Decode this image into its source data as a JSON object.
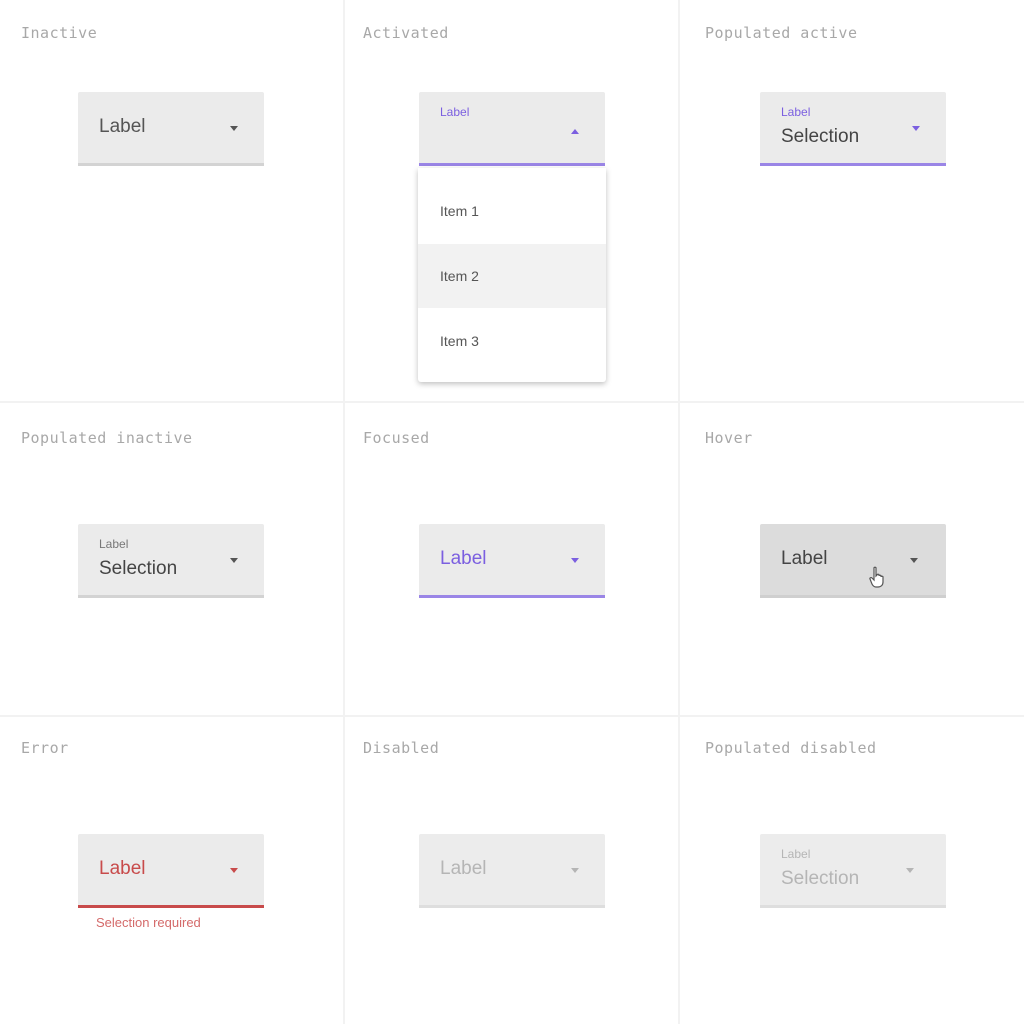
{
  "cells": {
    "inactive": {
      "title": "Inactive",
      "label": "Label"
    },
    "activated": {
      "title": "Activated",
      "label": "Label",
      "menu_items": [
        "Item 1",
        "Item 2",
        "Item 3"
      ],
      "highlighted_item_index": 1
    },
    "populated_active": {
      "title": "Populated active",
      "label": "Label",
      "selection": "Selection"
    },
    "populated_inactive": {
      "title": "Populated inactive",
      "label": "Label",
      "selection": "Selection"
    },
    "focused": {
      "title": "Focused",
      "label": "Label"
    },
    "hover": {
      "title": "Hover",
      "label": "Label"
    },
    "error": {
      "title": "Error",
      "label": "Label",
      "helper": "Selection required"
    },
    "disabled": {
      "title": "Disabled",
      "label": "Label"
    },
    "populated_disabled": {
      "title": "Populated disabled",
      "label": "Label",
      "selection": "Selection"
    }
  },
  "colors": {
    "accent": "#7b5fe0",
    "error": "#c84b4b",
    "field_bg": "#ebebeb",
    "hover_bg": "#dcdcdc"
  },
  "icons": {
    "dropdown": "chevron-down-icon",
    "dropdown_open": "chevron-up-icon",
    "cursor": "hand-pointer-icon"
  }
}
